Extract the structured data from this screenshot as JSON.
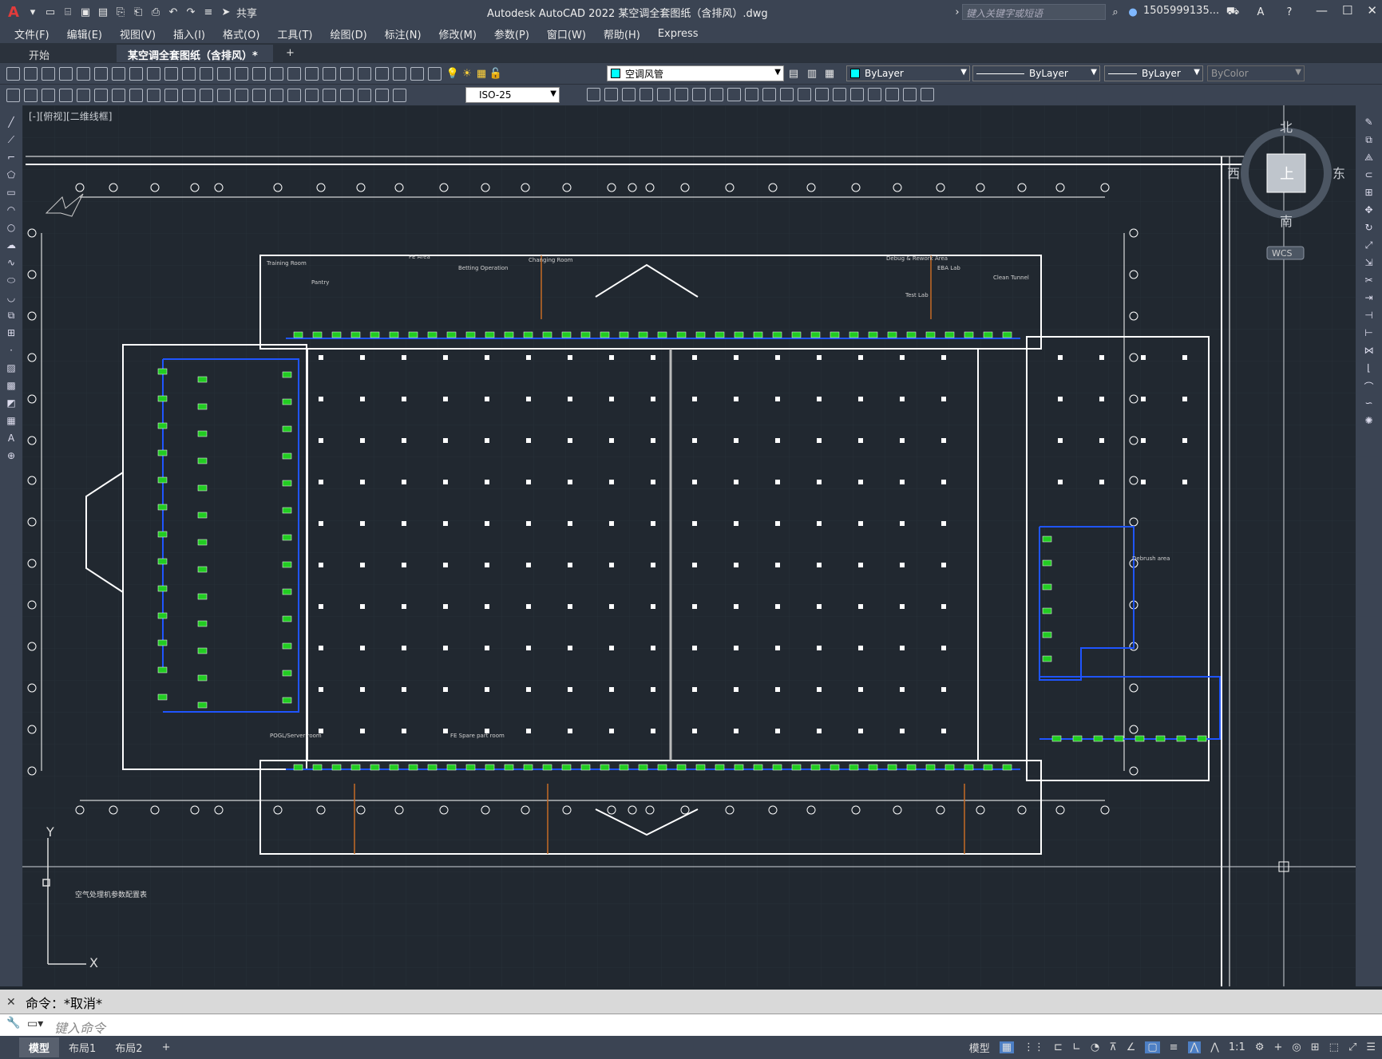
{
  "app": {
    "title": "Autodesk AutoCAD 2022    某空调全套图纸（含排风）.dwg",
    "search_placeholder": "键入关键字或短语",
    "user": "1505999135...",
    "logo": "A"
  },
  "menu": [
    "文件(F)",
    "编辑(E)",
    "视图(V)",
    "插入(I)",
    "格式(O)",
    "工具(T)",
    "绘图(D)",
    "标注(N)",
    "修改(M)",
    "参数(P)",
    "窗口(W)",
    "帮助(H)",
    "Express"
  ],
  "file_tabs": [
    {
      "label": "开始",
      "active": false
    },
    {
      "label": "某空调全套图纸（含排风）*",
      "active": true
    }
  ],
  "share_label": "共享",
  "toolbar": {
    "layer_name": "空调风管",
    "color": "ByLayer",
    "linetype": "ByLayer",
    "lineweight": "ByLayer",
    "plotstyle": "ByColor",
    "dimstyle": "ISO-25"
  },
  "viewport_label": "[-][俯视][二维线框]",
  "viewcube": {
    "north": "北",
    "south": "南",
    "east": "东",
    "west": "西",
    "top": "上",
    "ucs": "WCS"
  },
  "drawing": {
    "footer_note": "空气处理机参数配置表",
    "rooms": [
      "Training Room",
      "Pantry",
      "FE Area",
      "Betting Operation",
      "Changing Room",
      "Debug & Rework Area",
      "EBA Lab",
      "Test Lab",
      "Clean Tunnel",
      "Debrush area",
      "POGL/Server room",
      "FE Spare part room"
    ]
  },
  "command": {
    "history": "命令：*取消*",
    "placeholder": "键入命令"
  },
  "layout_tabs": [
    {
      "label": "模型",
      "active": true
    },
    {
      "label": "布局1",
      "active": false
    },
    {
      "label": "布局2",
      "active": false
    }
  ],
  "status": {
    "model": "模型",
    "scale": "1:1"
  },
  "colors": {
    "background": "#212830",
    "chrome": "#3b4453",
    "duct": "#1f55ff",
    "unit": "#22cc22",
    "wall": "#ffffff",
    "door": "#c56b25"
  }
}
